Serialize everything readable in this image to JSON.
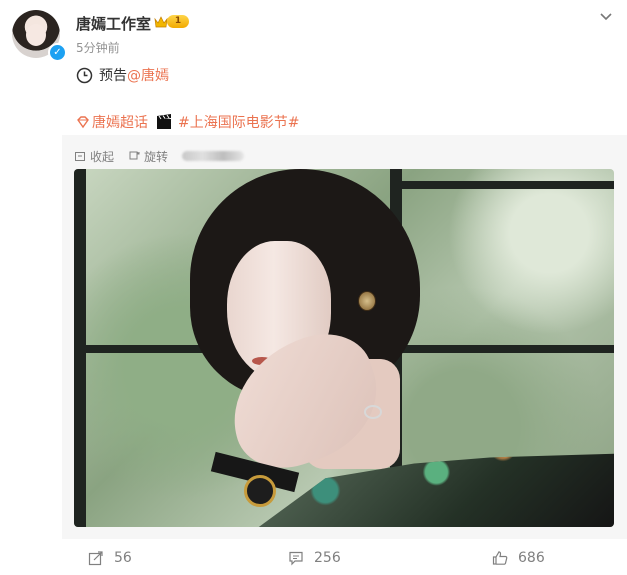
{
  "post": {
    "username": "唐嫣工作室",
    "level": "1",
    "timestamp": "5分钟前",
    "notice_prefix": "预告",
    "mention": "@唐嫣"
  },
  "tags": {
    "supertopic": "唐嫣超话",
    "hashtag": "#上海国际电影节#"
  },
  "repost": {
    "collapse_label": "收起",
    "rotate_label": "旋转"
  },
  "stats": {
    "reposts": "56",
    "comments": "256",
    "likes": "686"
  },
  "colors": {
    "accent": "#eb7350",
    "muted": "#808080",
    "panel": "#f6f6f6"
  },
  "icons": {
    "header_menu": "chevron-down-icon",
    "notice": "clock-icon",
    "tag": "diamond-icon",
    "media_tag": "clapper-icon",
    "repost": "share-icon",
    "comment": "comment-icon",
    "like": "thumb-icon"
  }
}
